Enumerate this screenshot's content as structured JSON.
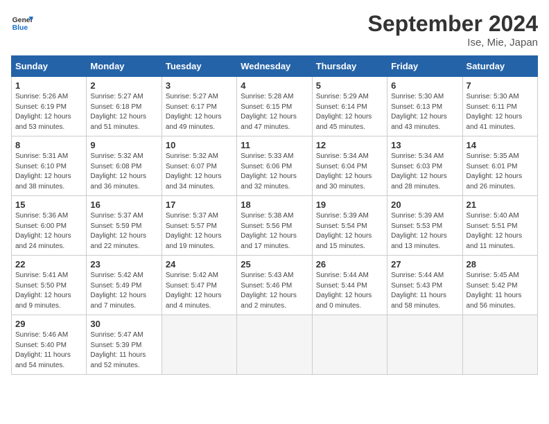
{
  "header": {
    "logo_line1": "General",
    "logo_line2": "Blue",
    "month": "September 2024",
    "location": "Ise, Mie, Japan"
  },
  "weekdays": [
    "Sunday",
    "Monday",
    "Tuesday",
    "Wednesday",
    "Thursday",
    "Friday",
    "Saturday"
  ],
  "days": [
    {
      "num": "",
      "detail": ""
    },
    {
      "num": "",
      "detail": ""
    },
    {
      "num": "",
      "detail": ""
    },
    {
      "num": "",
      "detail": ""
    },
    {
      "num": "",
      "detail": ""
    },
    {
      "num": "",
      "detail": ""
    },
    {
      "num": "7",
      "detail": "Sunrise: 5:30 AM\nSunset: 6:11 PM\nDaylight: 12 hours\nand 41 minutes."
    },
    {
      "num": "8",
      "detail": "Sunrise: 5:31 AM\nSunset: 6:10 PM\nDaylight: 12 hours\nand 38 minutes."
    },
    {
      "num": "9",
      "detail": "Sunrise: 5:32 AM\nSunset: 6:08 PM\nDaylight: 12 hours\nand 36 minutes."
    },
    {
      "num": "10",
      "detail": "Sunrise: 5:32 AM\nSunset: 6:07 PM\nDaylight: 12 hours\nand 34 minutes."
    },
    {
      "num": "11",
      "detail": "Sunrise: 5:33 AM\nSunset: 6:06 PM\nDaylight: 12 hours\nand 32 minutes."
    },
    {
      "num": "12",
      "detail": "Sunrise: 5:34 AM\nSunset: 6:04 PM\nDaylight: 12 hours\nand 30 minutes."
    },
    {
      "num": "13",
      "detail": "Sunrise: 5:34 AM\nSunset: 6:03 PM\nDaylight: 12 hours\nand 28 minutes."
    },
    {
      "num": "14",
      "detail": "Sunrise: 5:35 AM\nSunset: 6:01 PM\nDaylight: 12 hours\nand 26 minutes."
    },
    {
      "num": "15",
      "detail": "Sunrise: 5:36 AM\nSunset: 6:00 PM\nDaylight: 12 hours\nand 24 minutes."
    },
    {
      "num": "16",
      "detail": "Sunrise: 5:37 AM\nSunset: 5:59 PM\nDaylight: 12 hours\nand 22 minutes."
    },
    {
      "num": "17",
      "detail": "Sunrise: 5:37 AM\nSunset: 5:57 PM\nDaylight: 12 hours\nand 19 minutes."
    },
    {
      "num": "18",
      "detail": "Sunrise: 5:38 AM\nSunset: 5:56 PM\nDaylight: 12 hours\nand 17 minutes."
    },
    {
      "num": "19",
      "detail": "Sunrise: 5:39 AM\nSunset: 5:54 PM\nDaylight: 12 hours\nand 15 minutes."
    },
    {
      "num": "20",
      "detail": "Sunrise: 5:39 AM\nSunset: 5:53 PM\nDaylight: 12 hours\nand 13 minutes."
    },
    {
      "num": "21",
      "detail": "Sunrise: 5:40 AM\nSunset: 5:51 PM\nDaylight: 12 hours\nand 11 minutes."
    },
    {
      "num": "22",
      "detail": "Sunrise: 5:41 AM\nSunset: 5:50 PM\nDaylight: 12 hours\nand 9 minutes."
    },
    {
      "num": "23",
      "detail": "Sunrise: 5:42 AM\nSunset: 5:49 PM\nDaylight: 12 hours\nand 7 minutes."
    },
    {
      "num": "24",
      "detail": "Sunrise: 5:42 AM\nSunset: 5:47 PM\nDaylight: 12 hours\nand 4 minutes."
    },
    {
      "num": "25",
      "detail": "Sunrise: 5:43 AM\nSunset: 5:46 PM\nDaylight: 12 hours\nand 2 minutes."
    },
    {
      "num": "26",
      "detail": "Sunrise: 5:44 AM\nSunset: 5:44 PM\nDaylight: 12 hours\nand 0 minutes."
    },
    {
      "num": "27",
      "detail": "Sunrise: 5:44 AM\nSunset: 5:43 PM\nDaylight: 11 hours\nand 58 minutes."
    },
    {
      "num": "28",
      "detail": "Sunrise: 5:45 AM\nSunset: 5:42 PM\nDaylight: 11 hours\nand 56 minutes."
    },
    {
      "num": "29",
      "detail": "Sunrise: 5:46 AM\nSunset: 5:40 PM\nDaylight: 11 hours\nand 54 minutes."
    },
    {
      "num": "30",
      "detail": "Sunrise: 5:47 AM\nSunset: 5:39 PM\nDaylight: 11 hours\nand 52 minutes."
    },
    {
      "num": "",
      "detail": ""
    },
    {
      "num": "",
      "detail": ""
    },
    {
      "num": "",
      "detail": ""
    },
    {
      "num": "",
      "detail": ""
    },
    {
      "num": "",
      "detail": ""
    }
  ],
  "week1": [
    {
      "num": "1",
      "detail": "Sunrise: 5:26 AM\nSunset: 6:19 PM\nDaylight: 12 hours\nand 53 minutes."
    },
    {
      "num": "2",
      "detail": "Sunrise: 5:27 AM\nSunset: 6:18 PM\nDaylight: 12 hours\nand 51 minutes."
    },
    {
      "num": "3",
      "detail": "Sunrise: 5:27 AM\nSunset: 6:17 PM\nDaylight: 12 hours\nand 49 minutes."
    },
    {
      "num": "4",
      "detail": "Sunrise: 5:28 AM\nSunset: 6:15 PM\nDaylight: 12 hours\nand 47 minutes."
    },
    {
      "num": "5",
      "detail": "Sunrise: 5:29 AM\nSunset: 6:14 PM\nDaylight: 12 hours\nand 45 minutes."
    },
    {
      "num": "6",
      "detail": "Sunrise: 5:30 AM\nSunset: 6:13 PM\nDaylight: 12 hours\nand 43 minutes."
    },
    {
      "num": "7",
      "detail": "Sunrise: 5:30 AM\nSunset: 6:11 PM\nDaylight: 12 hours\nand 41 minutes."
    }
  ]
}
